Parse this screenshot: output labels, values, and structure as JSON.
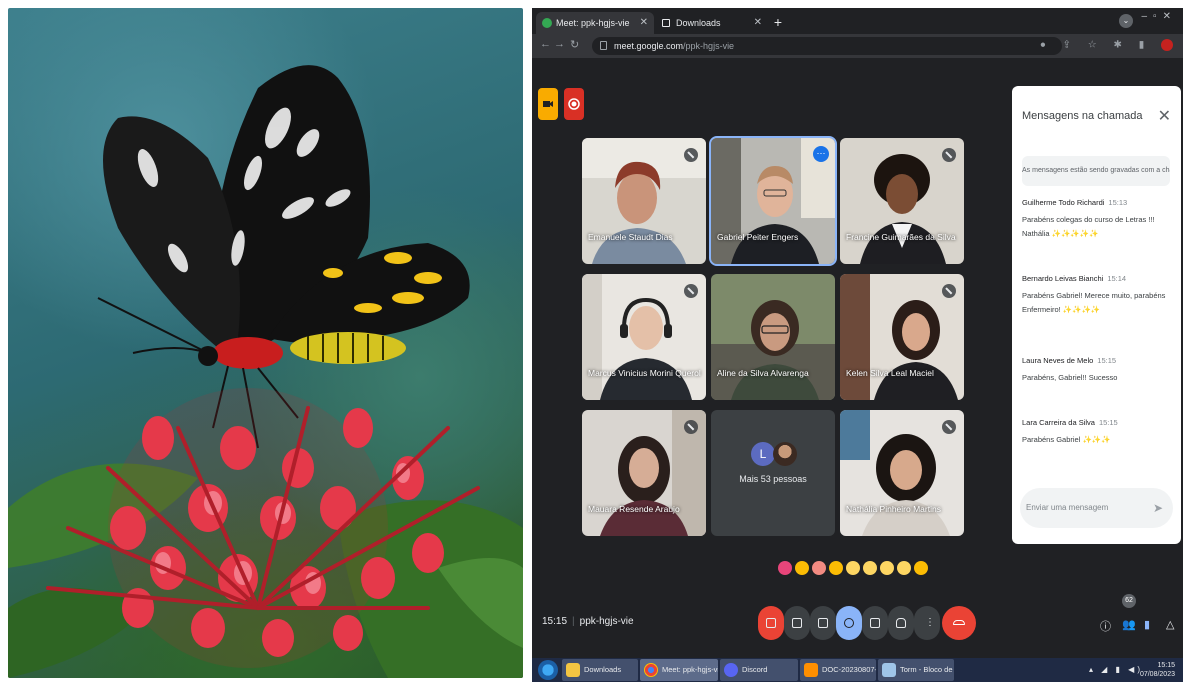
{
  "browser": {
    "tabs": [
      {
        "label": "Meet: ppk-hgjs-vie",
        "active": true
      },
      {
        "label": "Downloads",
        "active": false
      }
    ],
    "url_host": "meet.google.com",
    "url_path": "/ppk-hgjs-vie"
  },
  "meet": {
    "participants": [
      {
        "name": "Emanuele Staudt Dias"
      },
      {
        "name": "Gabriel Peiter Engers"
      },
      {
        "name": "Francine Guimarães da Silva"
      },
      {
        "name": "Marcus Vinicius Morini Querol"
      },
      {
        "name": "Aline da Silva Alvarenga"
      },
      {
        "name": "Kelen Silva Leal Maciel"
      },
      {
        "name": "Mauara Resende Araujo"
      },
      {
        "name": "Nathália Pinheiro Martins"
      }
    ],
    "more_people": "Mais 53 pessoas",
    "more_avatar_letter": "L",
    "meeting_time": "15:15",
    "meeting_code": "ppk-hgjs-vie",
    "people_count": "62"
  },
  "chat": {
    "title": "Mensagens na chamada",
    "notice": "As mensagens estão sendo gravadas com a chamada",
    "input_placeholder": "Enviar uma mensagem",
    "messages": [
      {
        "sender": "Guilherme Todo Richardi",
        "time": "15:13",
        "text": "Parabéns colegas do curso de Letras !!! Nathália ✨✨✨✨✨"
      },
      {
        "sender": "Bernardo Leivas Bianchi",
        "time": "15:14",
        "text": "Parabéns Gabriel! Merece muito, parabéns Enfermeiro! ✨✨✨✨"
      },
      {
        "sender": "Laura Neves de Melo",
        "time": "15:15",
        "text": "Parabéns, Gabriel!! Sucesso"
      },
      {
        "sender": "Lara Carreira da Silva",
        "time": "15:15",
        "text": "Parabéns Gabriel ✨✨✨"
      }
    ]
  },
  "taskbar": {
    "items": [
      "Downloads",
      "Meet: ppk-hgjs-vie",
      "Discord",
      "DOC-20230807-W...",
      "Torm - Bloco de n..."
    ],
    "clock_time": "15:15",
    "clock_date": "07/08/2023"
  },
  "colors": {
    "meet_bg": "#202124",
    "chat_bg": "#ffffff",
    "end_call": "#ea4335",
    "accent": "#8ab4f8"
  }
}
